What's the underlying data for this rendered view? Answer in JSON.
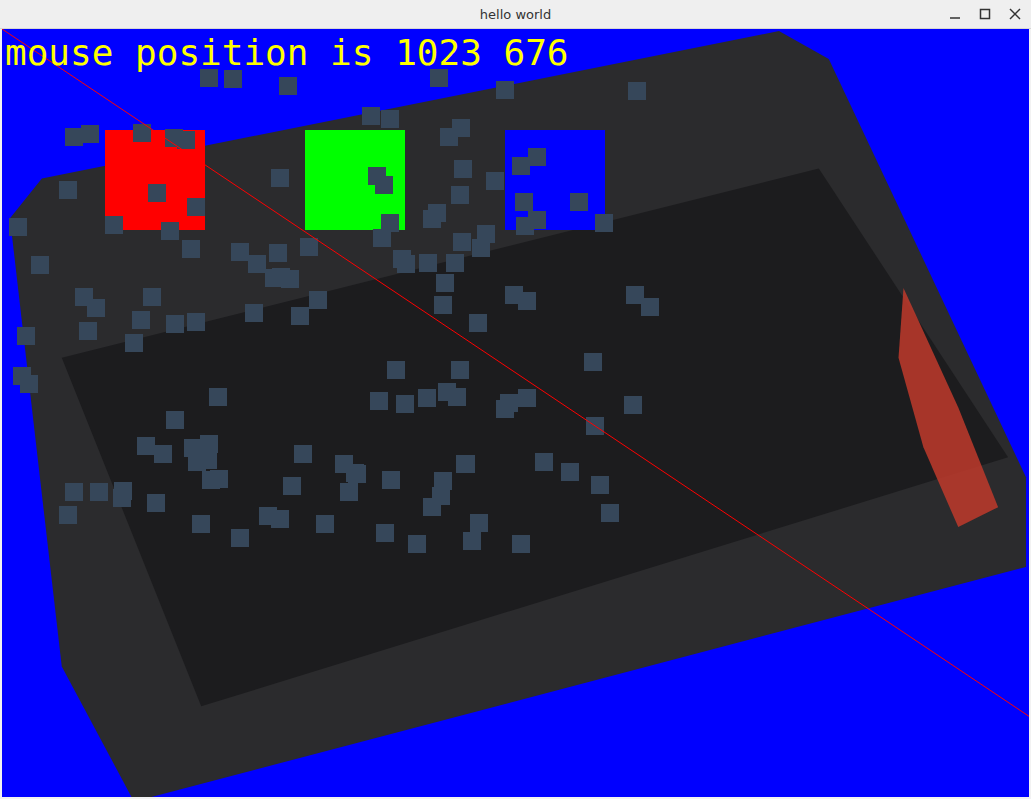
{
  "window": {
    "title": "hello world"
  },
  "status": "mouse position is 1023 676",
  "squares": [
    {
      "color": "#ff0000"
    },
    {
      "color": "#00ff00"
    },
    {
      "color": "#0000ff"
    }
  ]
}
